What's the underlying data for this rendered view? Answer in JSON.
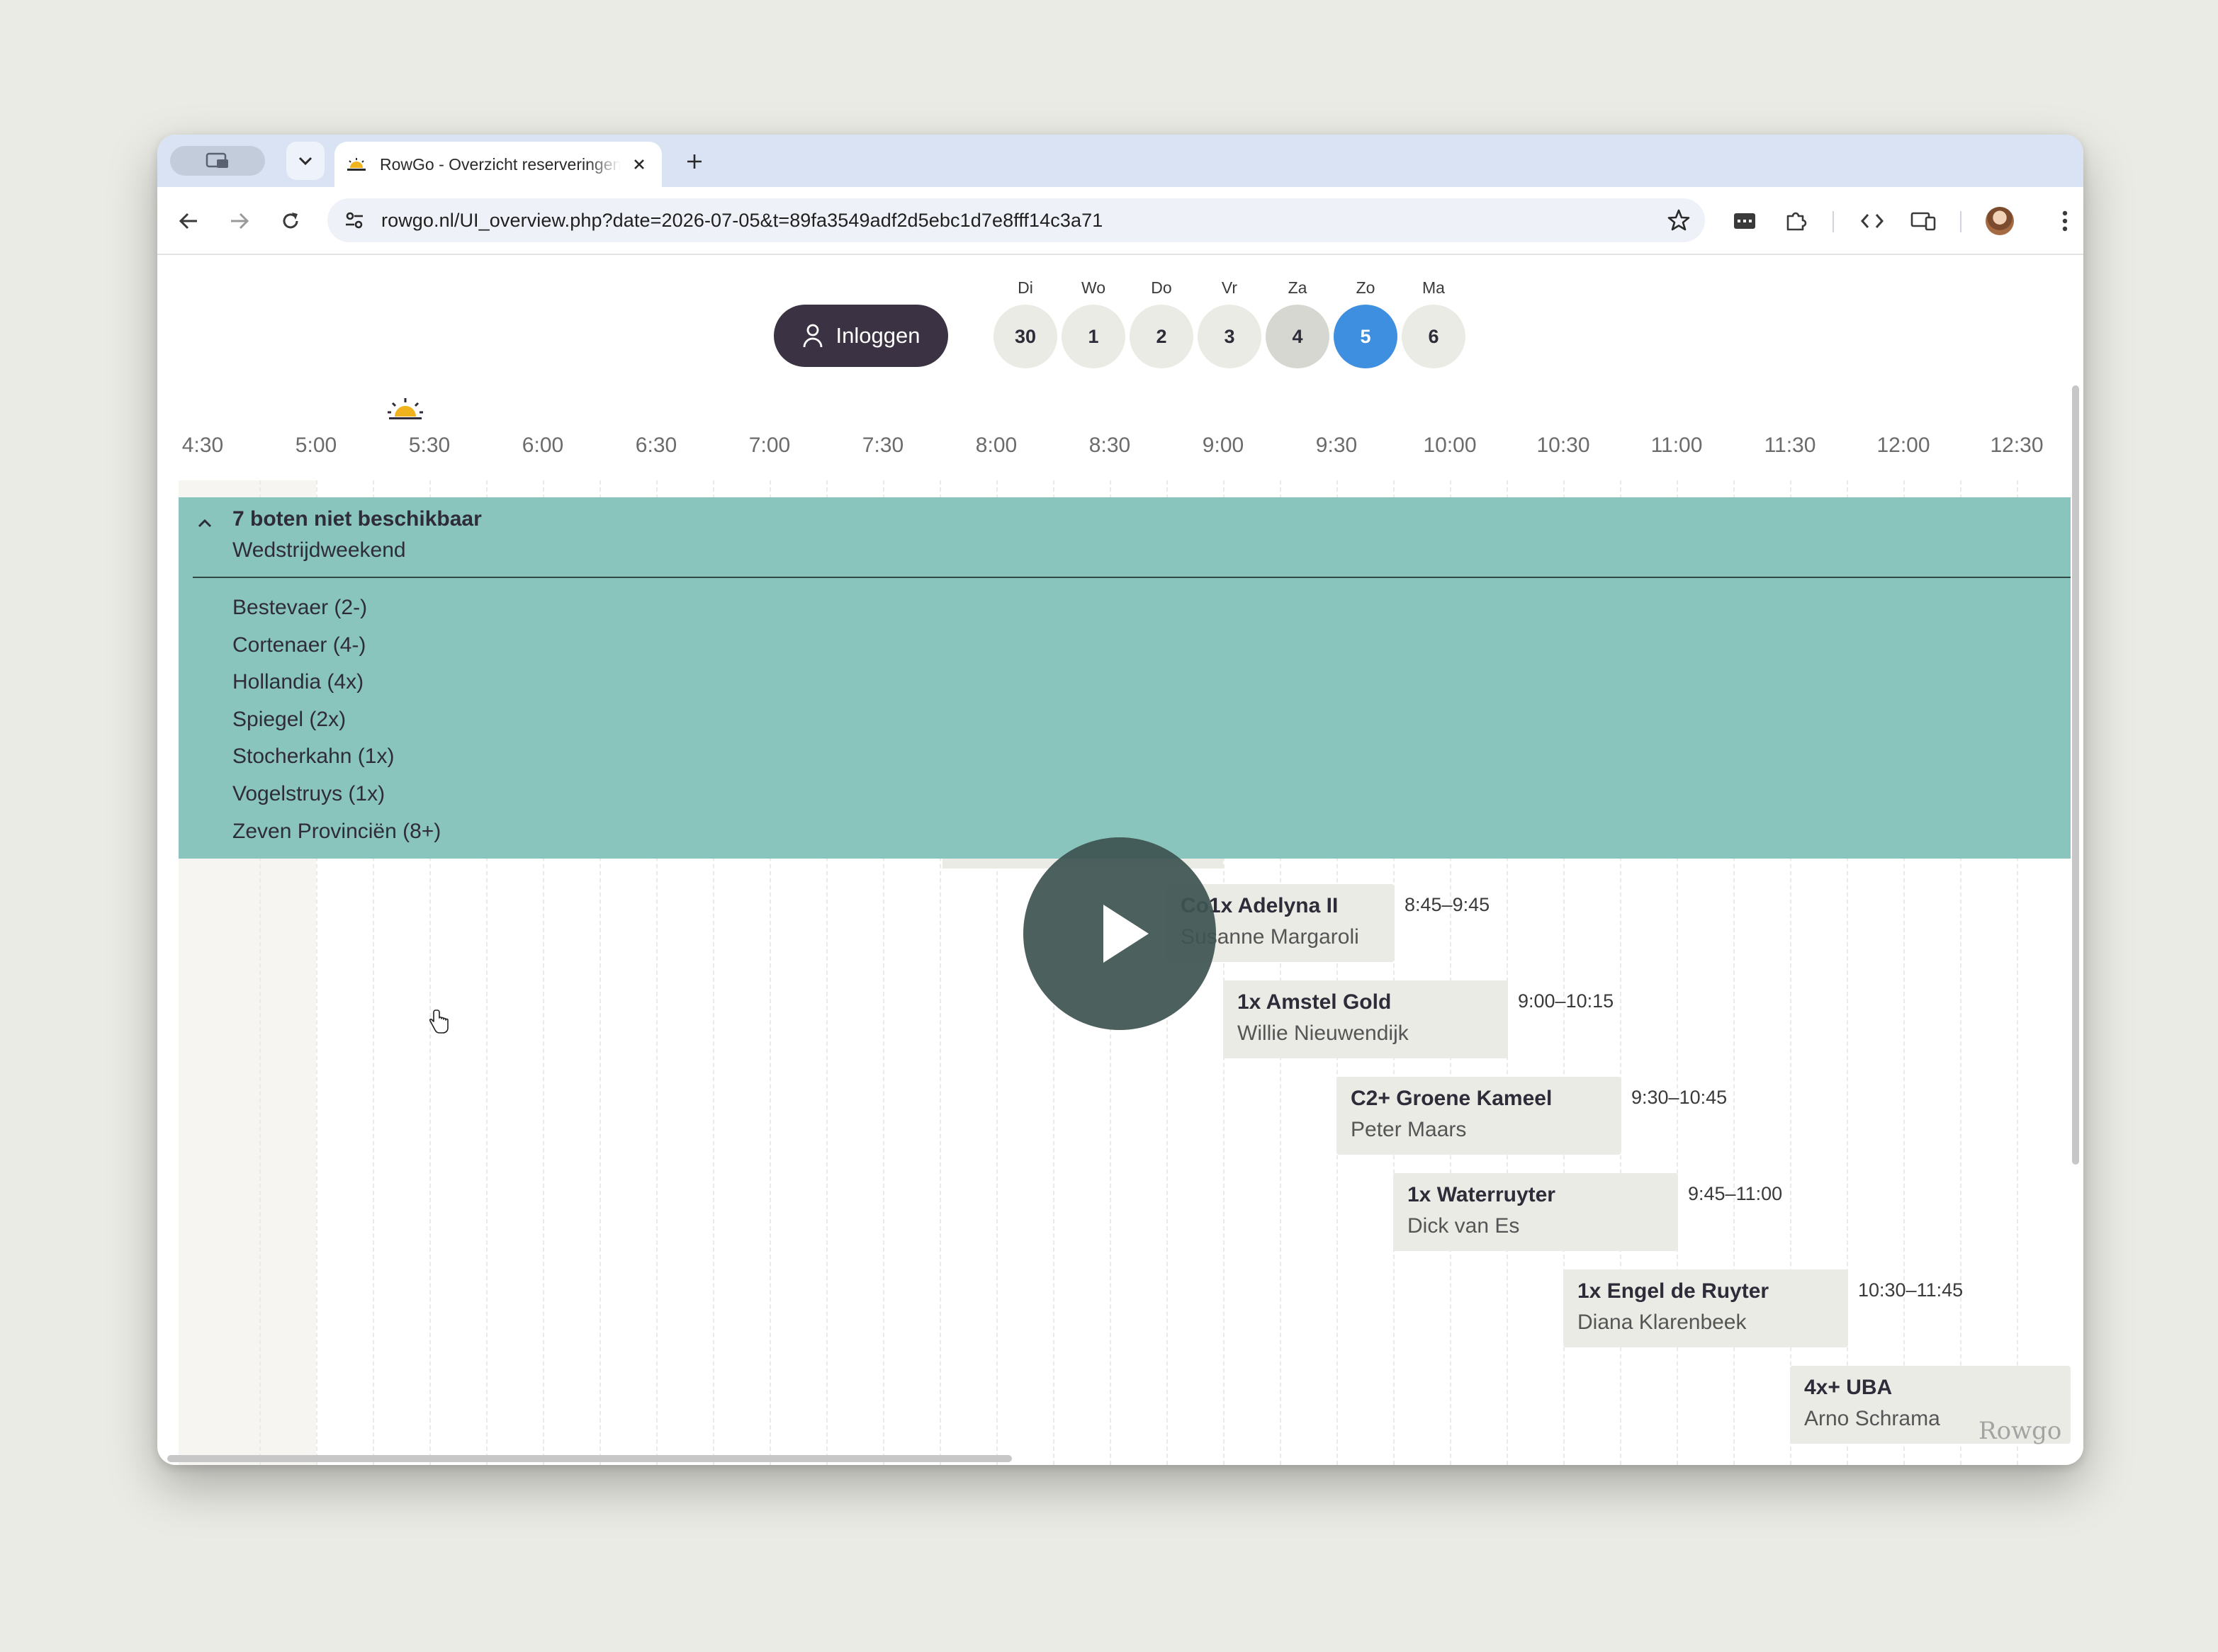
{
  "browser": {
    "tab_title": "RowGo - Overzicht reserveringen",
    "url": "rowgo.nl/UI_overview.php?date=2026-07-05&t=89fa3549adf2d5ebc1d7e8fff14c3a71"
  },
  "header": {
    "login_label": "Inloggen",
    "days": [
      {
        "label": "Di",
        "num": "30"
      },
      {
        "label": "Wo",
        "num": "1"
      },
      {
        "label": "Do",
        "num": "2"
      },
      {
        "label": "Vr",
        "num": "3"
      },
      {
        "label": "Za",
        "num": "4"
      },
      {
        "label": "Zo",
        "num": "5"
      },
      {
        "label": "Ma",
        "num": "6"
      }
    ],
    "selected_day": "5"
  },
  "timeline": {
    "ticks": [
      "4:30",
      "5:00",
      "5:30",
      "6:00",
      "6:30",
      "7:00",
      "7:30",
      "8:00",
      "8:30",
      "9:00",
      "9:30",
      "10:00",
      "10:30",
      "11:00",
      "11:30",
      "12:00",
      "12:30"
    ]
  },
  "unavailable": {
    "title": "7 boten niet beschikbaar",
    "reason": "Wedstrijdweekend",
    "boats": [
      "Bestevaer (2-)",
      "Cortenaer (4-)",
      "Hollandia (4x)",
      "Spiegel (2x)",
      "Stocherkahn (1x)",
      "Vogelstruys (1x)",
      "Zeven Provinciën (8+)"
    ]
  },
  "reservations": [
    {
      "boat": "Co1x Adelyna II",
      "name": "Susanne Margaroli",
      "time": "8:45–9:45"
    },
    {
      "boat": "1x Amstel Gold",
      "name": "Willie Nieuwendijk",
      "time": "9:00–10:15"
    },
    {
      "boat": "C2+ Groene Kameel",
      "name": "Peter Maars",
      "time": "9:30–10:45"
    },
    {
      "boat": "1x Waterruyter",
      "name": "Dick van Es",
      "time": "9:45–11:00"
    },
    {
      "boat": "1x Engel de Ruyter",
      "name": "Diana Klarenbeek",
      "time": "10:30–11:45"
    },
    {
      "boat": "4x+ UBA",
      "name": "Arno Schrama",
      "time": ""
    }
  ],
  "watermark": "Rowgo",
  "colors": {
    "accent": "#3f8fe0",
    "login_bg": "#3b3243",
    "unavailable_bg": "#89c5bc",
    "reservation_bg": "#ebebe5"
  }
}
